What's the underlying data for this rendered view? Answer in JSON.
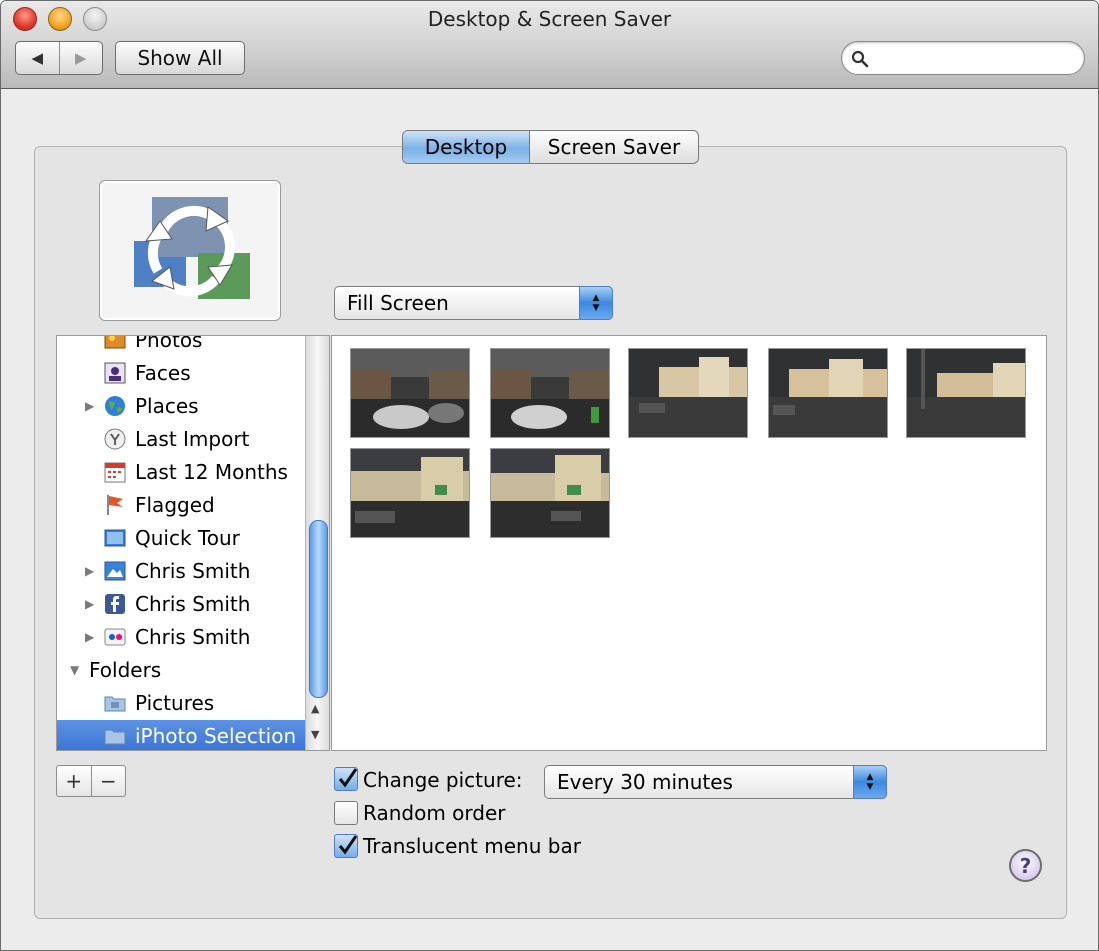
{
  "window": {
    "title": "Desktop & Screen Saver"
  },
  "toolbar": {
    "back_glyph": "◀",
    "forward_glyph": "▶",
    "show_all_label": "Show All",
    "search_value": "",
    "search_placeholder": ""
  },
  "tabs": [
    {
      "label": "Desktop",
      "selected": true
    },
    {
      "label": "Screen Saver",
      "selected": false
    }
  ],
  "preview": {
    "icon": "cycle-arrows-icon"
  },
  "fit_select": {
    "value": "Fill Screen"
  },
  "sources": {
    "items": [
      {
        "label": "Photos",
        "icon": "photos-icon",
        "disclosure": ""
      },
      {
        "label": "Faces",
        "icon": "faces-icon",
        "disclosure": ""
      },
      {
        "label": "Places",
        "icon": "globe-icon",
        "disclosure": "▶"
      },
      {
        "label": "Last Import",
        "icon": "last-import-icon",
        "disclosure": ""
      },
      {
        "label": "Last 12 Months",
        "icon": "calendar-icon",
        "disclosure": ""
      },
      {
        "label": "Flagged",
        "icon": "flag-icon",
        "disclosure": ""
      },
      {
        "label": "Quick Tour",
        "icon": "quick-tour-icon",
        "disclosure": ""
      },
      {
        "label": "Chris Smith",
        "icon": "mobileme-icon",
        "disclosure": "▶"
      },
      {
        "label": "Chris Smith",
        "icon": "facebook-icon",
        "disclosure": "▶"
      },
      {
        "label": "Chris Smith",
        "icon": "flickr-icon",
        "disclosure": "▶"
      }
    ],
    "folders_group": {
      "label": "Folders",
      "disclosure": "▼"
    },
    "folders": [
      {
        "label": "Pictures",
        "icon": "folder-icon",
        "selected": false
      },
      {
        "label": "iPhoto Selection",
        "icon": "folder-icon",
        "selected": true
      }
    ]
  },
  "gallery": {
    "thumbnails": [
      {
        "name": "photo-1"
      },
      {
        "name": "photo-2"
      },
      {
        "name": "photo-3"
      },
      {
        "name": "photo-4"
      },
      {
        "name": "photo-5"
      },
      {
        "name": "photo-6"
      },
      {
        "name": "photo-7"
      }
    ]
  },
  "list_buttons": {
    "add": "+",
    "remove": "−"
  },
  "options": {
    "change_picture": {
      "label": "Change picture:",
      "checked": true
    },
    "interval": {
      "value": "Every 30 minutes"
    },
    "random_order": {
      "label": "Random order",
      "checked": false
    },
    "translucent_menu_bar": {
      "label": "Translucent menu bar",
      "checked": true
    }
  },
  "help": {
    "label": "?"
  },
  "colors": {
    "selection": "#3a73d6",
    "accent": "#7ab1e6"
  }
}
